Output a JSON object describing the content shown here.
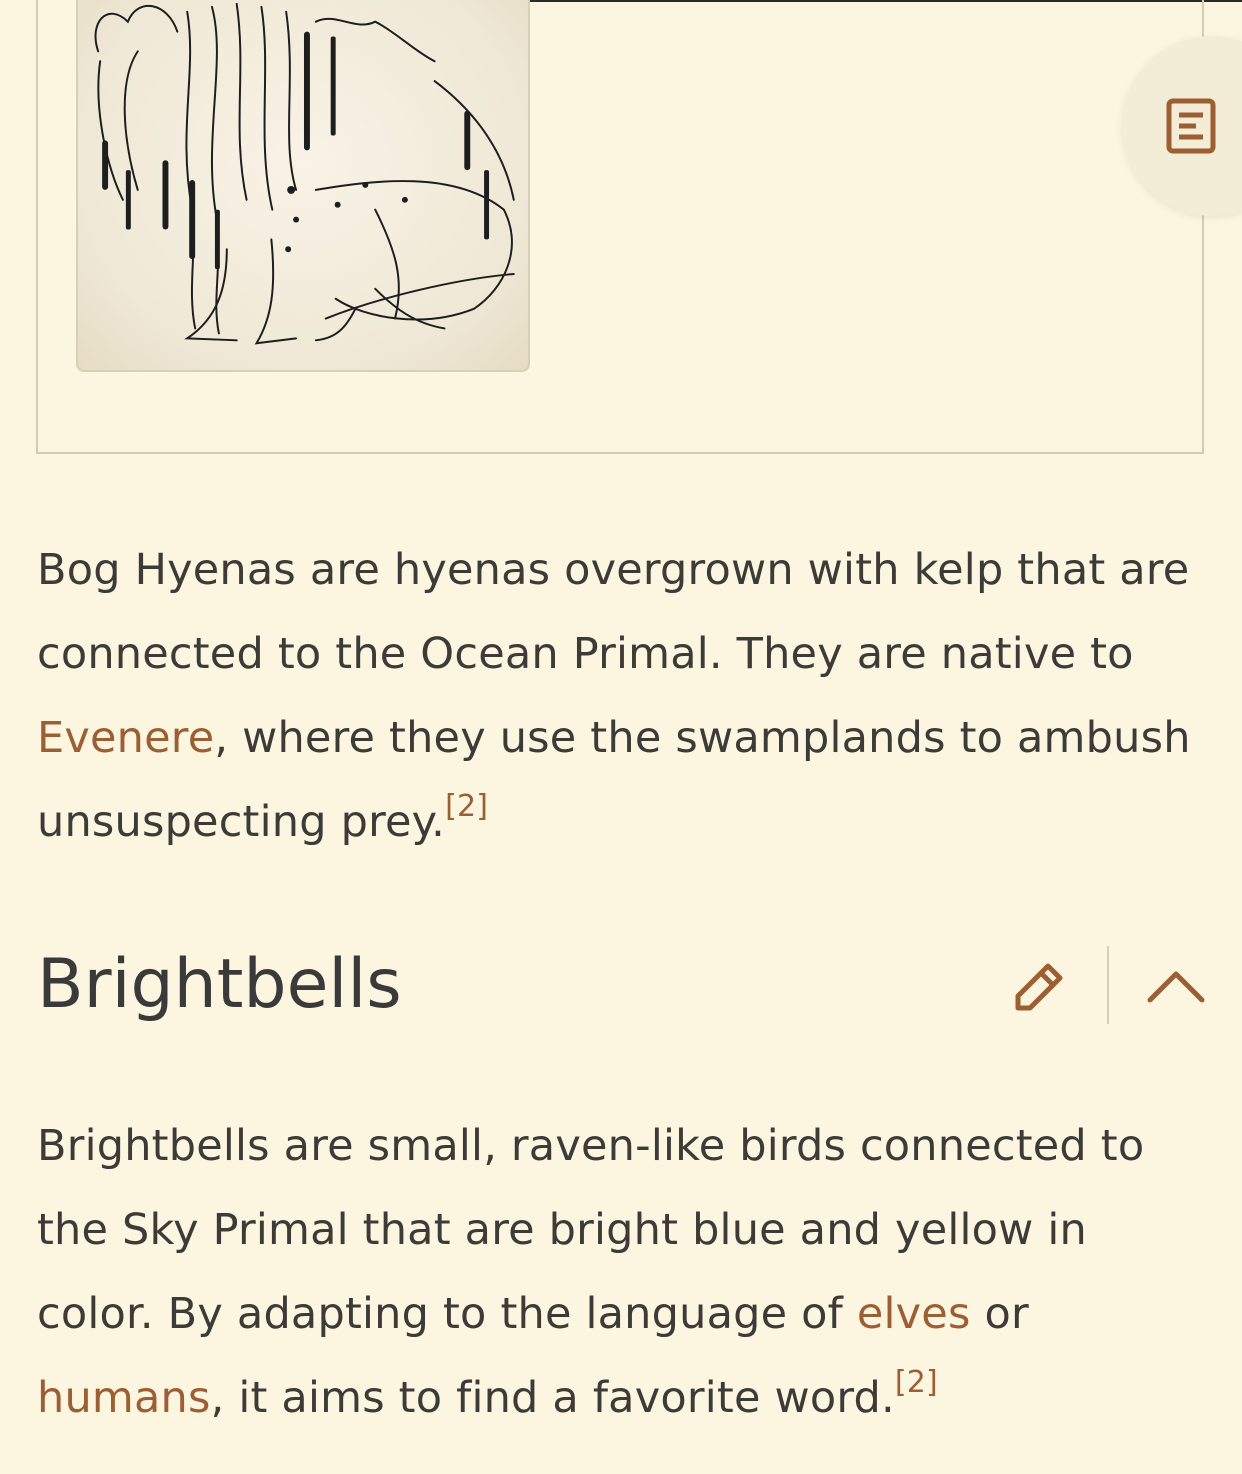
{
  "article": {
    "figure": {
      "image_subject": "bog hyena sketch"
    },
    "paragraph_1": {
      "text_before_link": "Bog Hyenas are hyenas overgrown with kelp that are connected to the Ocean Primal. They are native to ",
      "link_evenere": "Evenere",
      "text_after_link": ", where they use the swamplands to ambush unsuspecting prey.",
      "reference": "[2]"
    },
    "section": {
      "heading": "Brightbells"
    },
    "paragraph_2": {
      "text_before_link_1": "Brightbells are small, raven-like birds connected to the Sky Primal that are bright blue and yellow in color. By adapting to the language of ",
      "link_elves": "elves",
      "text_between_links": " or ",
      "link_humans": "humans",
      "text_after_links": ", it aims to find a favorite word.",
      "reference": "[2]"
    }
  },
  "controls": {
    "toc_icon": "table-of-contents-icon",
    "edit_icon": "pencil-icon",
    "collapse_icon": "chevron-up-icon"
  },
  "colors": {
    "background": "#fcf6e1",
    "link": "#9c5e33",
    "text": "#3d3b38"
  }
}
